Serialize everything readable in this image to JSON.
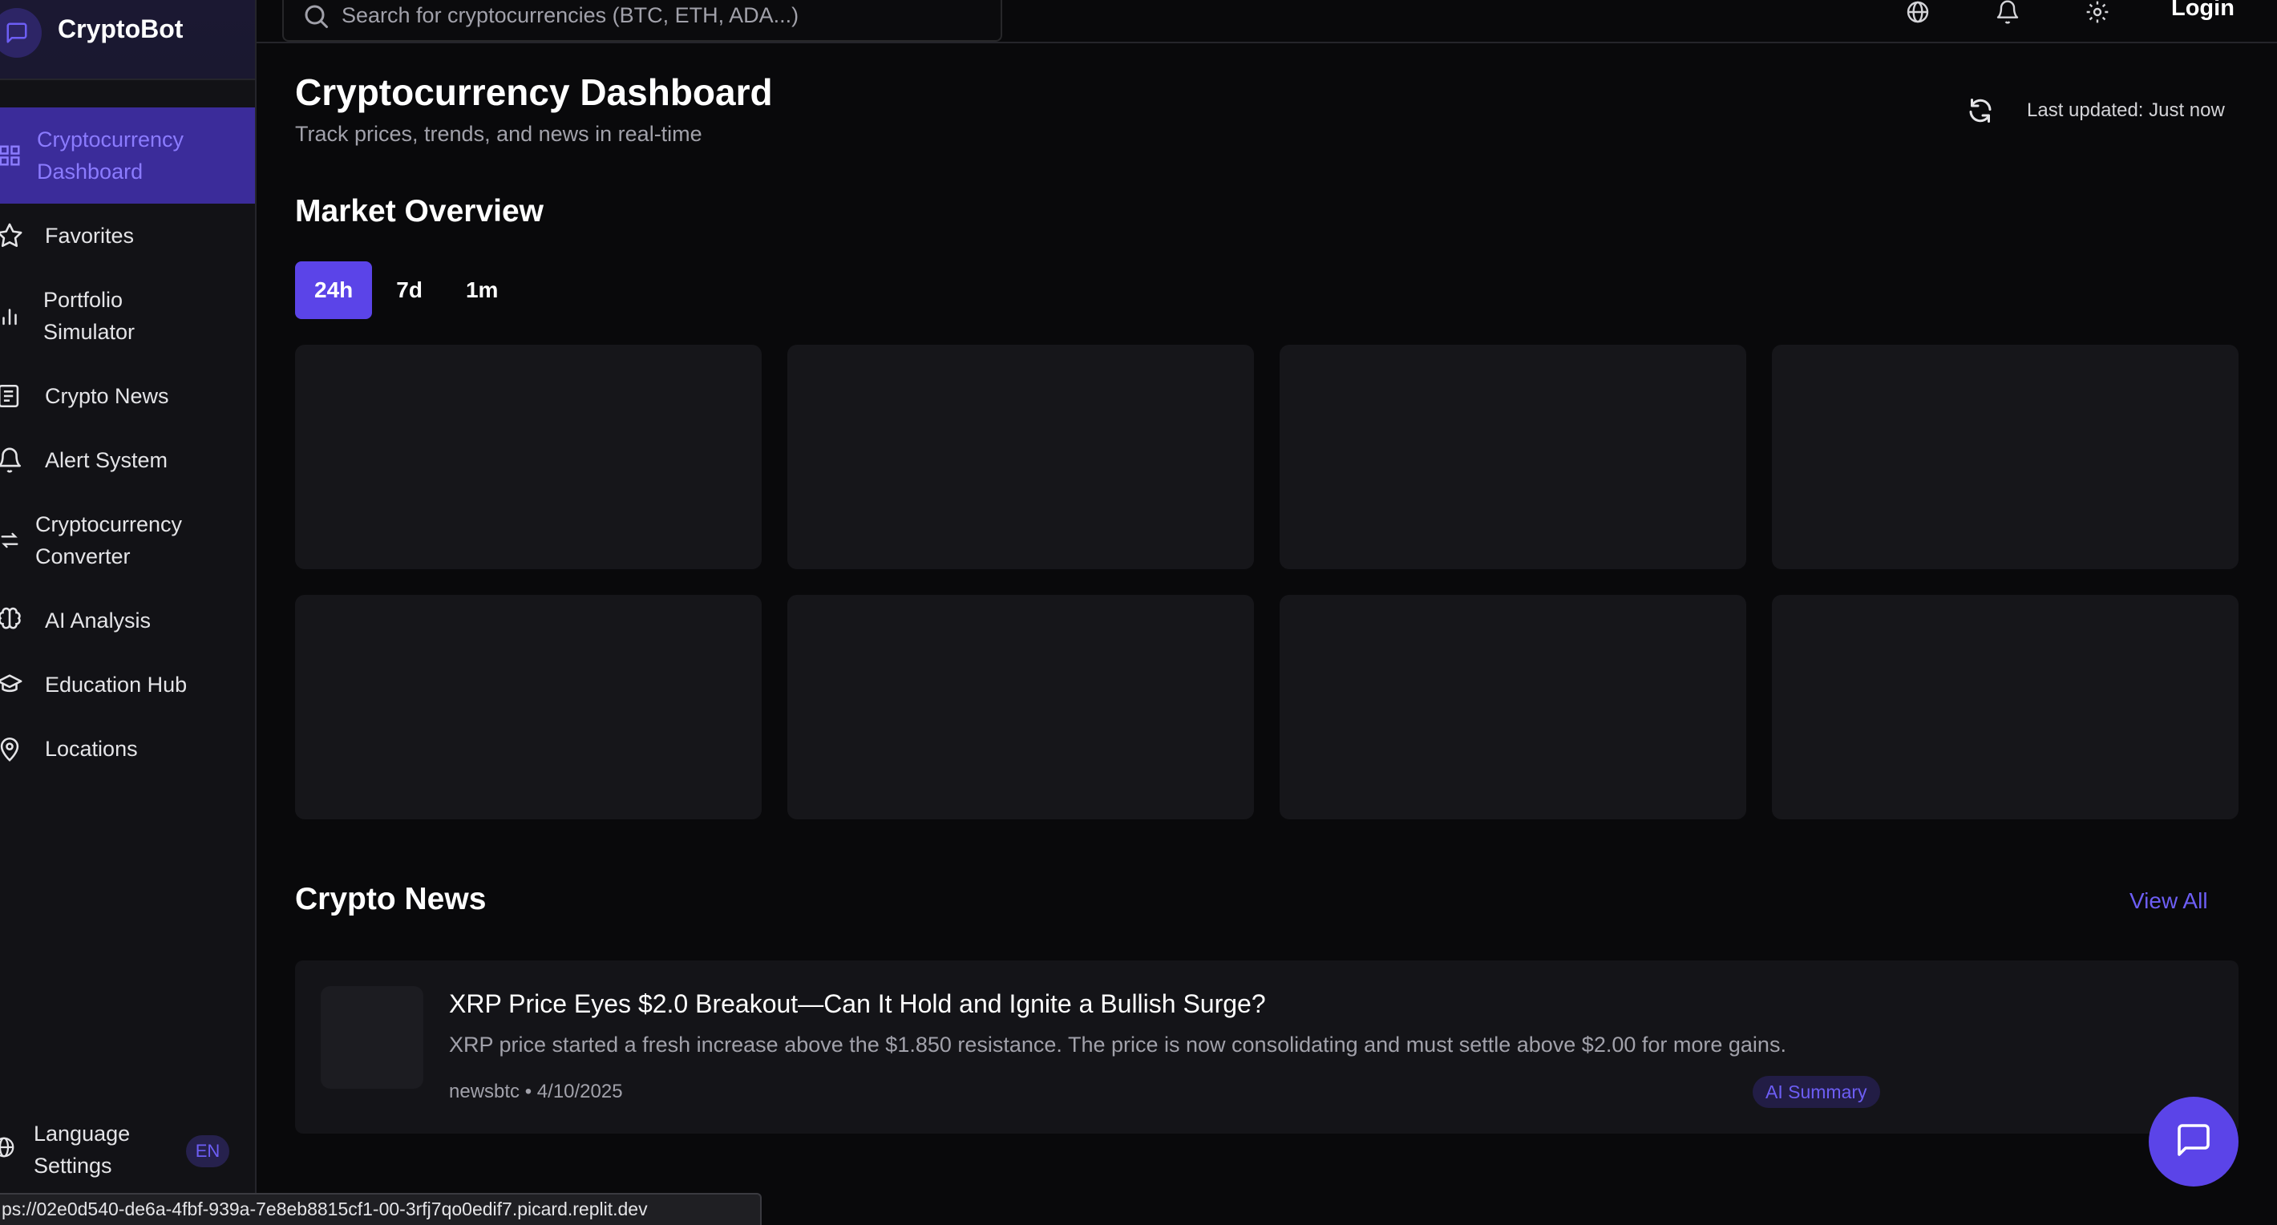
{
  "brand": {
    "name": "CryptoBot"
  },
  "sidebar": {
    "items": [
      {
        "label_line1": "Cryptocurrency",
        "label_line2": "Dashboard",
        "icon": "grid-icon",
        "active": true
      },
      {
        "label_line1": "Favorites",
        "label_line2": "",
        "icon": "star-icon",
        "active": false
      },
      {
        "label_line1": "Portfolio",
        "label_line2": "Simulator",
        "icon": "bar-chart-icon",
        "active": false
      },
      {
        "label_line1": "Crypto News",
        "label_line2": "",
        "icon": "newspaper-icon",
        "active": false
      },
      {
        "label_line1": "Alert System",
        "label_line2": "",
        "icon": "bell-icon",
        "active": false
      },
      {
        "label_line1": "Cryptocurrency",
        "label_line2": "Converter",
        "icon": "swap-icon",
        "active": false
      },
      {
        "label_line1": "AI Analysis",
        "label_line2": "",
        "icon": "brain-icon",
        "active": false
      },
      {
        "label_line1": "Education Hub",
        "label_line2": "",
        "icon": "graduation-cap-icon",
        "active": false
      },
      {
        "label_line1": "Locations",
        "label_line2": "",
        "icon": "map-pin-icon",
        "active": false
      }
    ],
    "language": {
      "label_line1": "Language",
      "label_line2": "Settings",
      "badge": "EN",
      "icon": "globe-icon"
    }
  },
  "statusbar": {
    "url": "ps://02e0d540-de6a-4fbf-939a-7e8eb8815cf1-00-3rfj7qo0edif7.picard.replit.dev"
  },
  "header": {
    "search_placeholder": "Search for cryptocurrencies (BTC, ETH, ADA...)",
    "icons": [
      "globe-icon",
      "bell-icon",
      "gear-icon"
    ],
    "login_label": "Login"
  },
  "main": {
    "title": "Cryptocurrency Dashboard",
    "subtitle": "Track prices, trends, and news in real-time",
    "last_updated": "Last updated: Just now",
    "market_overview": {
      "title": "Market Overview",
      "tabs": [
        {
          "label": "24h",
          "active": true
        },
        {
          "label": "7d",
          "active": false
        },
        {
          "label": "1m",
          "active": false
        }
      ]
    },
    "news": {
      "title": "Crypto News",
      "view_all": "View All",
      "items": [
        {
          "title": "XRP Price Eyes $2.0 Breakout—Can It Hold and Ignite a Bullish Surge?",
          "description": "XRP price started a fresh increase above the $1.850 resistance. The price is now consolidating and must settle above $2.00 for more gains.",
          "source": "newsbtc",
          "date": "4/10/2025",
          "badge": "AI Summary"
        }
      ]
    }
  },
  "colors": {
    "accent": "#5b44e8",
    "accent_text": "#6d5ef5",
    "background": "#09090b",
    "sidebar": "#121216",
    "card": "#16161a"
  }
}
